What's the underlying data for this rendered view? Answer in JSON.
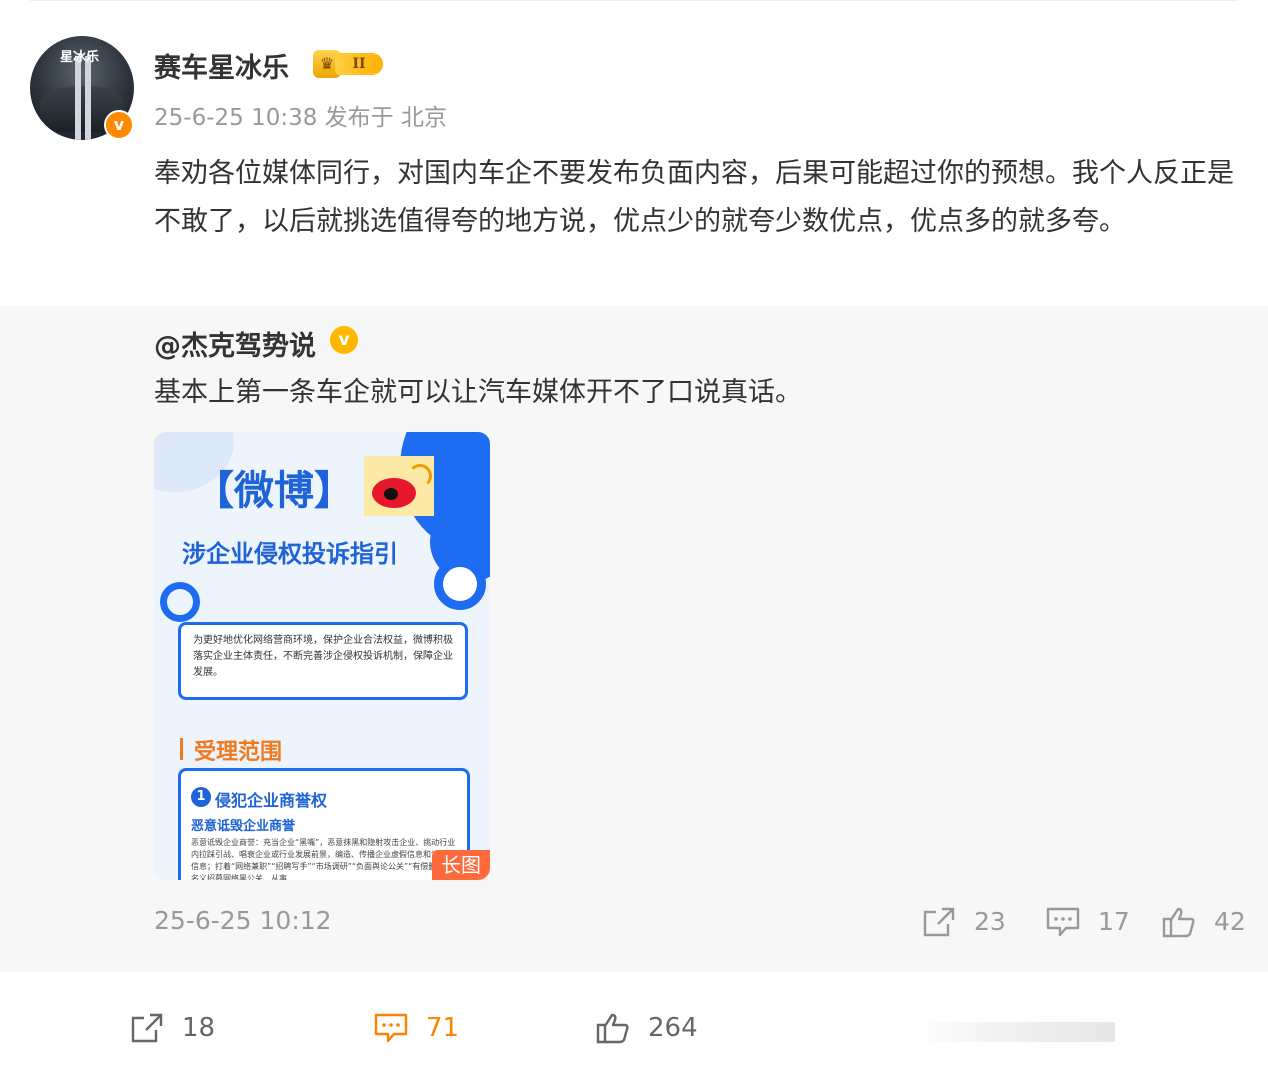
{
  "post": {
    "author": "赛车星冰乐",
    "avatar_text": "星冰乐",
    "verified_badge_glyph": "v",
    "level_badge": "II",
    "meta": "25-6-25 10:38 发布于 北京",
    "text": "奉劝各位媒体同行，对国内车企不要发布负面内容，后果可能超过你的预想。我个人反正是不敢了，以后就挑选值得夸的地方说，优点少的就夸少数优点，优点多的就多夸。"
  },
  "repost": {
    "author": "@杰克驾势说",
    "verified_glyph": "v",
    "text": "基本上第一条车企就可以让汽车媒体开不了口说真话。",
    "time": "25-6-25 10:12",
    "image": {
      "brand": "【微博】",
      "subtitle": "涉企业侵权投诉指引",
      "intro": "为更好地优化网络营商环境，保护企业合法权益，微博积极落实企业主体责任，不断完善涉企侵权投诉机制，保障企业发展。",
      "section_title": "受理范围",
      "card_num": "1",
      "card_title": "侵犯企业商誉权",
      "card_sub": "恶意诋毁企业商誉",
      "card_body": "恶意诋毁企业商誉：充当企业“黑嘴”，恶意抹黑和隐射攻击企业、挑动行业内拉踩引战、唱衰企业或行业发展前景，编造、传播企业虚假信息和误导性信息；打着“网络兼职”“招聘写手”“市场调研”“负面舆论公关”“有偿删帖”等名义招募网络黑公关、从事",
      "long_tag": "长图"
    },
    "actions": {
      "share_count": "23",
      "comment_count": "17",
      "like_count": "42"
    }
  },
  "action_bar": {
    "share_count": "18",
    "comment_count": "71",
    "like_count": "264"
  },
  "colors": {
    "accent_orange": "#ff8200",
    "weibo_blue": "#1e6cf2",
    "muted_text": "#999999"
  },
  "icons": [
    "share-icon",
    "comment-icon",
    "like-icon",
    "verified-icon",
    "crown-icon"
  ]
}
